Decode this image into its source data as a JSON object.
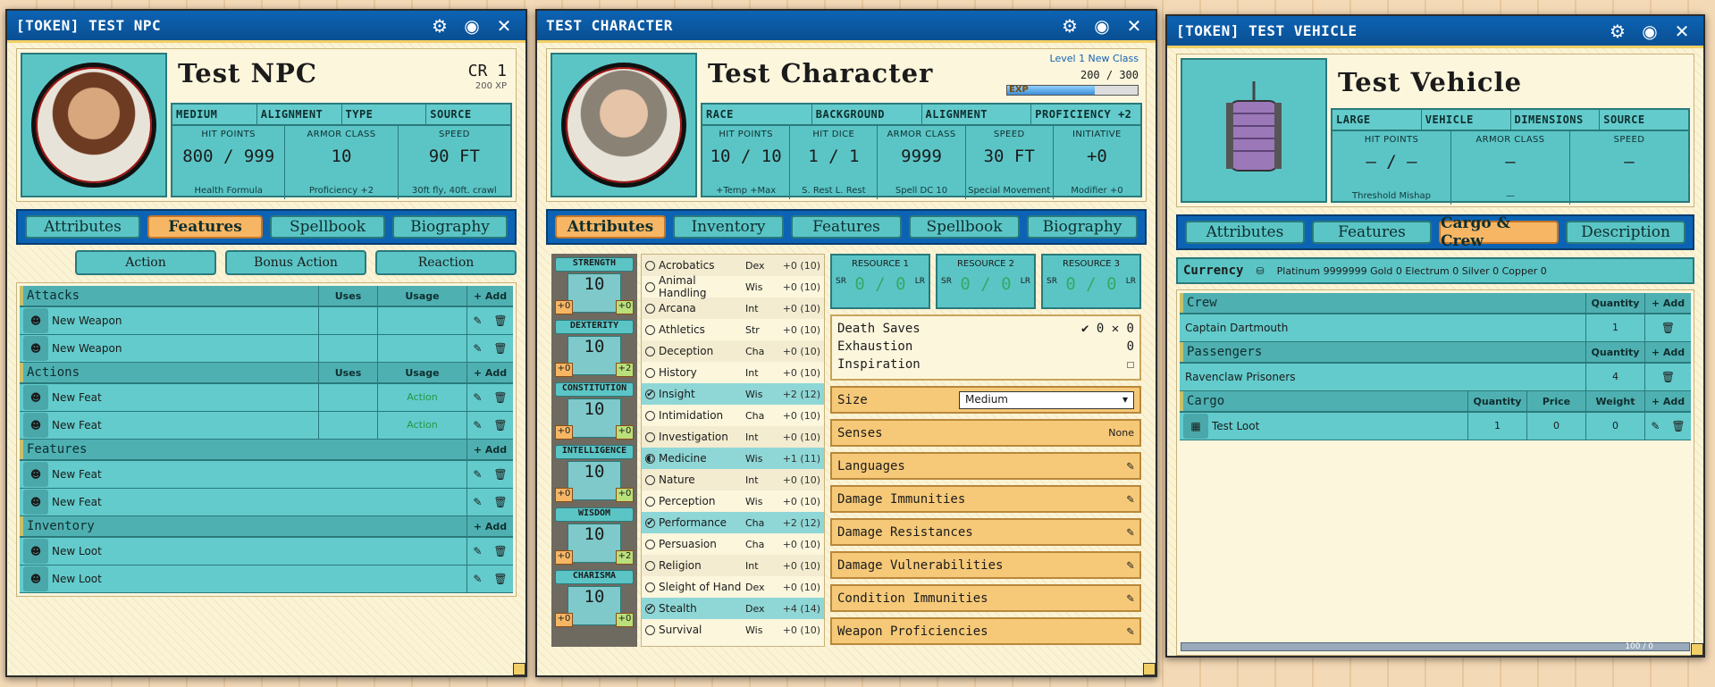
{
  "npc": {
    "title": "[TOKEN] TEST NPC",
    "name": "Test NPC",
    "cr": "CR 1",
    "xp": "200 XP",
    "headers": [
      "MEDIUM",
      "ALIGNMENT",
      "TYPE",
      "SOURCE"
    ],
    "stats": [
      {
        "label": "HIT POINTS",
        "value": "800 / 999",
        "sub": "Health Formula"
      },
      {
        "label": "ARMOR CLASS",
        "value": "10",
        "sub": "Proficiency +2"
      },
      {
        "label": "SPEED",
        "value": "90 FT",
        "sub": "30ft fly, 40ft. crawl"
      }
    ],
    "tabs": [
      "Attributes",
      "Features",
      "Spellbook",
      "Biography"
    ],
    "actions": [
      "Action",
      "Bonus Action",
      "Reaction"
    ],
    "sections": [
      {
        "title": "Attacks",
        "uses": "Uses",
        "usage": "Usage",
        "add": "+ Add",
        "items": [
          {
            "name": "New Weapon",
            "usage": ""
          },
          {
            "name": "New Weapon",
            "usage": ""
          }
        ]
      },
      {
        "title": "Actions",
        "uses": "Uses",
        "usage": "Usage",
        "add": "+ Add",
        "items": [
          {
            "name": "New Feat",
            "usage": "Action"
          },
          {
            "name": "New Feat",
            "usage": "Action"
          }
        ]
      },
      {
        "title": "Features",
        "uses": "",
        "usage": "",
        "add": "+ Add",
        "items": [
          {
            "name": "New Feat",
            "usage": ""
          },
          {
            "name": "New Feat",
            "usage": ""
          }
        ]
      },
      {
        "title": "Inventory",
        "uses": "",
        "usage": "",
        "add": "+ Add",
        "items": [
          {
            "name": "New Loot",
            "usage": ""
          },
          {
            "name": "New Loot",
            "usage": ""
          }
        ]
      }
    ]
  },
  "pc": {
    "title": "TEST CHARACTER",
    "name": "Test Character",
    "level": "Level 1 New Class",
    "exp": "200 / 300",
    "exp_label": "EXP",
    "exp_fraction": 0.67,
    "headers": [
      "RACE",
      "BACKGROUND",
      "ALIGNMENT",
      "PROFICIENCY +2"
    ],
    "stats": [
      {
        "label": "HIT POINTS",
        "value": "10 / 10",
        "sub": "+Temp     +Max"
      },
      {
        "label": "HIT DICE",
        "value": "1 / 1",
        "sub": "S. Rest  L. Rest"
      },
      {
        "label": "ARMOR CLASS",
        "value": "9999",
        "sub": "Spell DC 10"
      },
      {
        "label": "SPEED",
        "value": "30 FT",
        "sub": "Special Movement"
      },
      {
        "label": "INITIATIVE",
        "value": "+0",
        "sub": "Modifier   +0"
      }
    ],
    "tabs": [
      "Attributes",
      "Inventory",
      "Features",
      "Spellbook",
      "Biography"
    ],
    "abilities": [
      {
        "name": "STRENGTH",
        "score": "10",
        "mod": "+0",
        "save": "+0"
      },
      {
        "name": "DEXTERITY",
        "score": "10",
        "mod": "+0",
        "save": "+2"
      },
      {
        "name": "CONSTITUTION",
        "score": "10",
        "mod": "+0",
        "save": "+0"
      },
      {
        "name": "INTELLIGENCE",
        "score": "10",
        "mod": "+0",
        "save": "+0"
      },
      {
        "name": "WISDOM",
        "score": "10",
        "mod": "+0",
        "save": "+2"
      },
      {
        "name": "CHARISMA",
        "score": "10",
        "mod": "+0",
        "save": "+0"
      }
    ],
    "skills": [
      {
        "name": "Acrobatics",
        "abil": "Dex",
        "bonus": "+0 (10)",
        "p": ""
      },
      {
        "name": "Animal Handling",
        "abil": "Wis",
        "bonus": "+0 (10)",
        "p": ""
      },
      {
        "name": "Arcana",
        "abil": "Int",
        "bonus": "+0 (10)",
        "p": ""
      },
      {
        "name": "Athletics",
        "abil": "Str",
        "bonus": "+0 (10)",
        "p": ""
      },
      {
        "name": "Deception",
        "abil": "Cha",
        "bonus": "+0 (10)",
        "p": ""
      },
      {
        "name": "History",
        "abil": "Int",
        "bonus": "+0 (10)",
        "p": ""
      },
      {
        "name": "Insight",
        "abil": "Wis",
        "bonus": "+2 (12)",
        "p": "✔"
      },
      {
        "name": "Intimidation",
        "abil": "Cha",
        "bonus": "+0 (10)",
        "p": ""
      },
      {
        "name": "Investigation",
        "abil": "Int",
        "bonus": "+0 (10)",
        "p": ""
      },
      {
        "name": "Medicine",
        "abil": "Wis",
        "bonus": "+1 (11)",
        "p": "◐"
      },
      {
        "name": "Nature",
        "abil": "Int",
        "bonus": "+0 (10)",
        "p": ""
      },
      {
        "name": "Perception",
        "abil": "Wis",
        "bonus": "+0 (10)",
        "p": ""
      },
      {
        "name": "Performance",
        "abil": "Cha",
        "bonus": "+2 (12)",
        "p": "✔"
      },
      {
        "name": "Persuasion",
        "abil": "Cha",
        "bonus": "+0 (10)",
        "p": ""
      },
      {
        "name": "Religion",
        "abil": "Int",
        "bonus": "+0 (10)",
        "p": ""
      },
      {
        "name": "Sleight of Hand",
        "abil": "Dex",
        "bonus": "+0 (10)",
        "p": ""
      },
      {
        "name": "Stealth",
        "abil": "Dex",
        "bonus": "+4 (14)",
        "p": "✔"
      },
      {
        "name": "Survival",
        "abil": "Wis",
        "bonus": "+0 (10)",
        "p": ""
      }
    ],
    "resources": [
      {
        "label": "RESOURCE 1",
        "value": "0 / 0"
      },
      {
        "label": "RESOURCE 2",
        "value": "0 / 0"
      },
      {
        "label": "RESOURCE 3",
        "value": "0 / 0"
      }
    ],
    "sr": "SR",
    "lr": "LR",
    "death_saves": "Death Saves",
    "death_vals": "✔ 0  ✕ 0",
    "exhaustion": "Exhaustion",
    "exhaustion_val": "0",
    "inspiration": "Inspiration",
    "size_label": "Size",
    "size_value": "Medium",
    "senses": "Senses",
    "senses_value": "None",
    "props": [
      "Languages",
      "Damage Immunities",
      "Damage Resistances",
      "Damage Vulnerabilities",
      "Condition Immunities",
      "Weapon Proficiencies"
    ]
  },
  "veh": {
    "title": "[TOKEN] TEST VEHICLE",
    "name": "Test Vehicle",
    "headers": [
      "LARGE",
      "VEHICLE",
      "DIMENSIONS",
      "SOURCE"
    ],
    "stats": [
      {
        "label": "HIT POINTS",
        "value": "— / —",
        "sub": "Threshold       Mishap"
      },
      {
        "label": "ARMOR CLASS",
        "value": "—",
        "sub": "—"
      },
      {
        "label": "SPEED",
        "value": "—",
        "sub": ""
      }
    ],
    "tabs": [
      "Attributes",
      "Features",
      "Cargo & Crew",
      "Description"
    ],
    "currency_label": "Currency",
    "currency": "Platinum 9999999   Gold 0   Electrum 0   Silver 0   Copper 0",
    "crew": {
      "title": "Crew",
      "qty": "Quantity",
      "add": "+ Add",
      "items": [
        {
          "name": "Captain Dartmouth",
          "qty": "1"
        }
      ]
    },
    "passengers": {
      "title": "Passengers",
      "qty": "Quantity",
      "add": "+ Add",
      "items": [
        {
          "name": "Ravenclaw Prisoners",
          "qty": "4"
        }
      ]
    },
    "cargo": {
      "title": "Cargo",
      "qty": "Quantity",
      "price": "Price",
      "weight": "Weight",
      "add": "+ Add",
      "items": [
        {
          "name": "Test Loot",
          "qty": "1",
          "price": "0",
          "weight": "0"
        }
      ]
    },
    "scroll": "100 / 0"
  }
}
